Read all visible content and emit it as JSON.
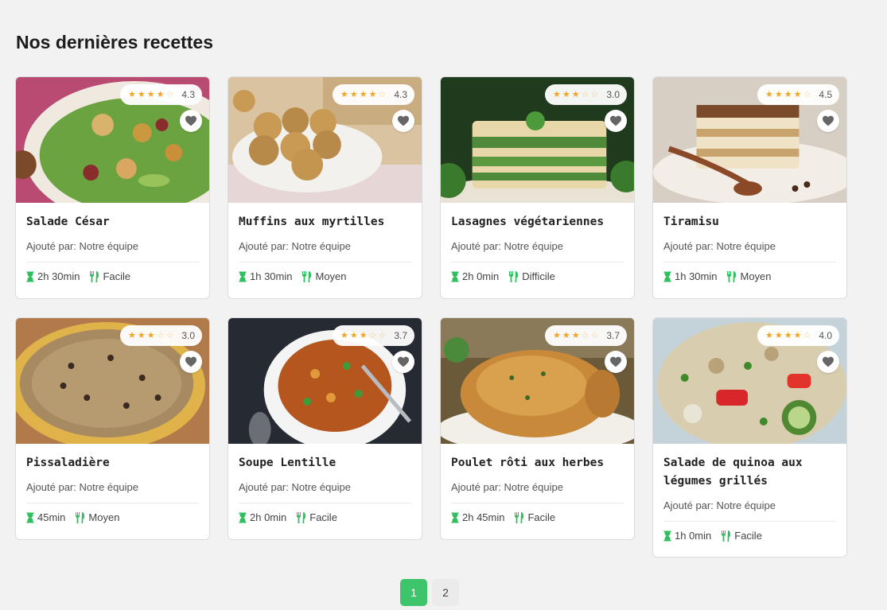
{
  "heading": "Nos dernières recettes",
  "colors": {
    "accent": "#3ec46a",
    "star": "#f2a422",
    "meta_icon": "#2fbf5f"
  },
  "author_prefix": "Ajouté par:",
  "recipes": [
    {
      "title": "Salade César",
      "author": "Notre équipe",
      "rating": "4.3",
      "stars": 4,
      "time": "2h 30min",
      "difficulty": "Facile"
    },
    {
      "title": "Muffins aux myrtilles",
      "author": "Notre équipe",
      "rating": "4.3",
      "stars": 4,
      "time": "1h 30min",
      "difficulty": "Moyen"
    },
    {
      "title": "Lasagnes végétariennes",
      "author": "Notre équipe",
      "rating": "3.0",
      "stars": 3,
      "time": "2h 0min",
      "difficulty": "Difficile"
    },
    {
      "title": "Tiramisu",
      "author": "Notre équipe",
      "rating": "4.5",
      "stars": 4,
      "time": "1h 30min",
      "difficulty": "Moyen"
    },
    {
      "title": "Pissaladière",
      "author": "Notre équipe",
      "rating": "3.0",
      "stars": 3,
      "time": "45min",
      "difficulty": "Moyen"
    },
    {
      "title": "Soupe Lentille",
      "author": "Notre équipe",
      "rating": "3.7",
      "stars": 3,
      "time": "2h 0min",
      "difficulty": "Facile"
    },
    {
      "title": "Poulet rôti aux herbes",
      "author": "Notre équipe",
      "rating": "3.7",
      "stars": 3,
      "time": "2h 45min",
      "difficulty": "Facile"
    },
    {
      "title": "Salade de quinoa aux légumes grillés",
      "author": "Notre équipe",
      "rating": "4.0",
      "stars": 4,
      "time": "1h 0min",
      "difficulty": "Facile"
    }
  ],
  "pagination": {
    "pages": [
      "1",
      "2"
    ],
    "current": "1"
  }
}
